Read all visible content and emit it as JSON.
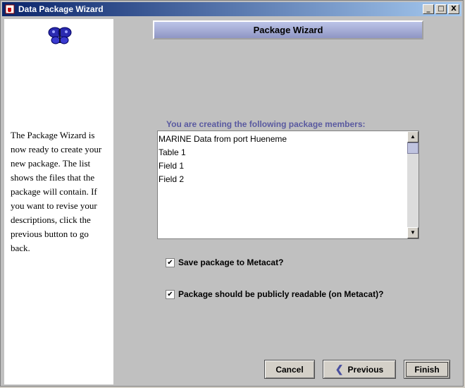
{
  "window": {
    "title": "Data Package Wizard"
  },
  "window_buttons": {
    "minimize": "_",
    "maximize": "□",
    "close": "X"
  },
  "left_panel": {
    "description": "The Package Wizard is now ready to create your new package. The list shows the files that the package will contain. If you want to revise your descriptions, click the previous button to go back."
  },
  "header": {
    "title": "Package Wizard"
  },
  "members": {
    "label": "You are creating the following package members:",
    "items": [
      "MARINE Data from port Hueneme",
      "Table 1",
      "Field 1",
      "Field 2"
    ]
  },
  "options": {
    "save_to_metacat": {
      "label": "Save package to Metacat?",
      "checked": true
    },
    "publicly_readable": {
      "label": "Package should be publicly readable (on Metacat)?",
      "checked": true
    }
  },
  "buttons": {
    "cancel": "Cancel",
    "previous": "Previous",
    "finish": "Finish"
  },
  "icons": {
    "app": "java-cup-icon",
    "logo": "butterfly-icon",
    "previous": "chevron-left-icon"
  },
  "colors": {
    "title_bar": "#0a246a",
    "header_band": "#a0a8d8",
    "label_text": "#5a5aa0"
  }
}
